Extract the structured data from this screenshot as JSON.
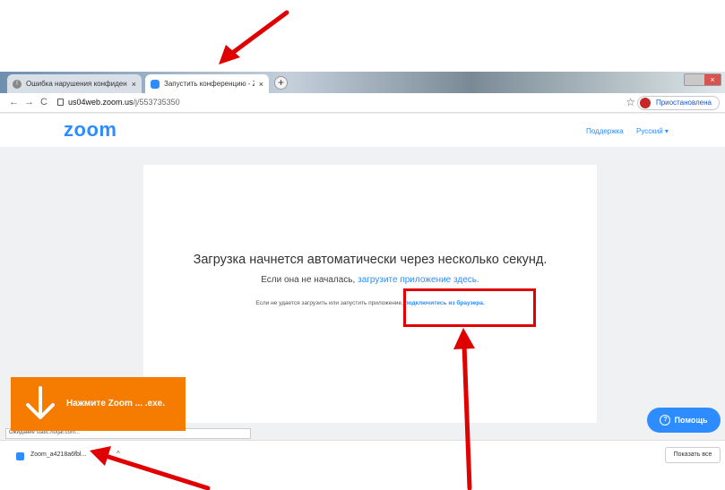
{
  "browser": {
    "tabs": [
      {
        "label": "Ошибка нарушения конфиден...",
        "close": "×"
      },
      {
        "label": "Запустить конференцию - Zoo...",
        "close": "×"
      }
    ],
    "new_tab": "+",
    "url_host": "us04web.zoom.us",
    "url_path": "/j/553735350",
    "profile_label": "Приостановлена",
    "nav": {
      "back": "←",
      "forward": "→",
      "reload": "C"
    },
    "star": "☆"
  },
  "zoom": {
    "logo": "zoom",
    "support": "Поддержка",
    "language": "Русский ▾",
    "heading": "Загрузка начнется автоматически через несколько секунд.",
    "sub_text": "Если она не началась,",
    "sub_link": "загрузите приложение здесь.",
    "small_text": "Если не удается загрузить или запустить приложение,",
    "small_link": "подключитесь из браузера.",
    "help_label": "Помощь"
  },
  "status_text": "Ожидание static.hotjar.com...",
  "download": {
    "filename": "Zoom_a4218a6fbl...",
    "caret": "^",
    "show_all": "Показать все"
  },
  "overlay": {
    "text": "Нажмите Zoom ... .exe.",
    "color": "#f57c00"
  },
  "colors": {
    "accent": "#2d8cff",
    "annotation": "#e10000"
  }
}
